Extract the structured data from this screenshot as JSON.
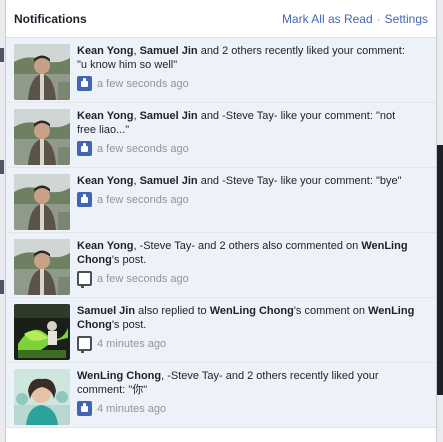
{
  "header": {
    "title": "Notifications",
    "mark_all_read": "Mark All as Read",
    "separator": "·",
    "settings": "Settings"
  },
  "notifications": [
    {
      "parts": [
        {
          "text": "Kean Yong",
          "bold": true
        },
        {
          "text": ", ",
          "bold": false
        },
        {
          "text": "Samuel Jin",
          "bold": true
        },
        {
          "text": " and 2 others recently liked your comment: \"u know him so well\"",
          "bold": false
        }
      ],
      "time": "a few seconds ago",
      "icon": "like-icon",
      "avatar": "avatar-man-outdoors"
    },
    {
      "parts": [
        {
          "text": "Kean Yong",
          "bold": true
        },
        {
          "text": ", ",
          "bold": false
        },
        {
          "text": "Samuel Jin",
          "bold": true
        },
        {
          "text": " and -Steve Tay- like your comment: \"not free liao...\"",
          "bold": false
        }
      ],
      "time": "a few seconds ago",
      "icon": "like-icon",
      "avatar": "avatar-man-outdoors"
    },
    {
      "parts": [
        {
          "text": "Kean Yong",
          "bold": true
        },
        {
          "text": ", ",
          "bold": false
        },
        {
          "text": "Samuel Jin",
          "bold": true
        },
        {
          "text": " and -Steve Tay- like your comment: \"bye\"",
          "bold": false
        }
      ],
      "time": "a few seconds ago",
      "icon": "like-icon",
      "avatar": "avatar-man-outdoors"
    },
    {
      "parts": [
        {
          "text": "Kean Yong",
          "bold": true
        },
        {
          "text": ", -Steve Tay- and 2 others also commented on ",
          "bold": false
        },
        {
          "text": "WenLing Chong",
          "bold": true
        },
        {
          "text": "'s post.",
          "bold": false
        }
      ],
      "time": "a few seconds ago",
      "icon": "comment-icon",
      "avatar": "avatar-man-outdoors"
    },
    {
      "parts": [
        {
          "text": "Samuel Jin",
          "bold": true
        },
        {
          "text": " also replied to ",
          "bold": false
        },
        {
          "text": "WenLing Chong",
          "bold": true
        },
        {
          "text": "'s comment on ",
          "bold": false
        },
        {
          "text": "WenLing Chong",
          "bold": true
        },
        {
          "text": "'s post.",
          "bold": false
        }
      ],
      "time": "4 minutes ago",
      "icon": "comment-icon",
      "avatar": "avatar-green-splash"
    },
    {
      "parts": [
        {
          "text": "WenLing Chong",
          "bold": true
        },
        {
          "text": ", -Steve Tay- and 2 others recently liked your comment: \"你\"",
          "bold": false
        }
      ],
      "time": "4 minutes ago",
      "icon": "like-icon",
      "avatar": "avatar-woman-teal"
    }
  ]
}
